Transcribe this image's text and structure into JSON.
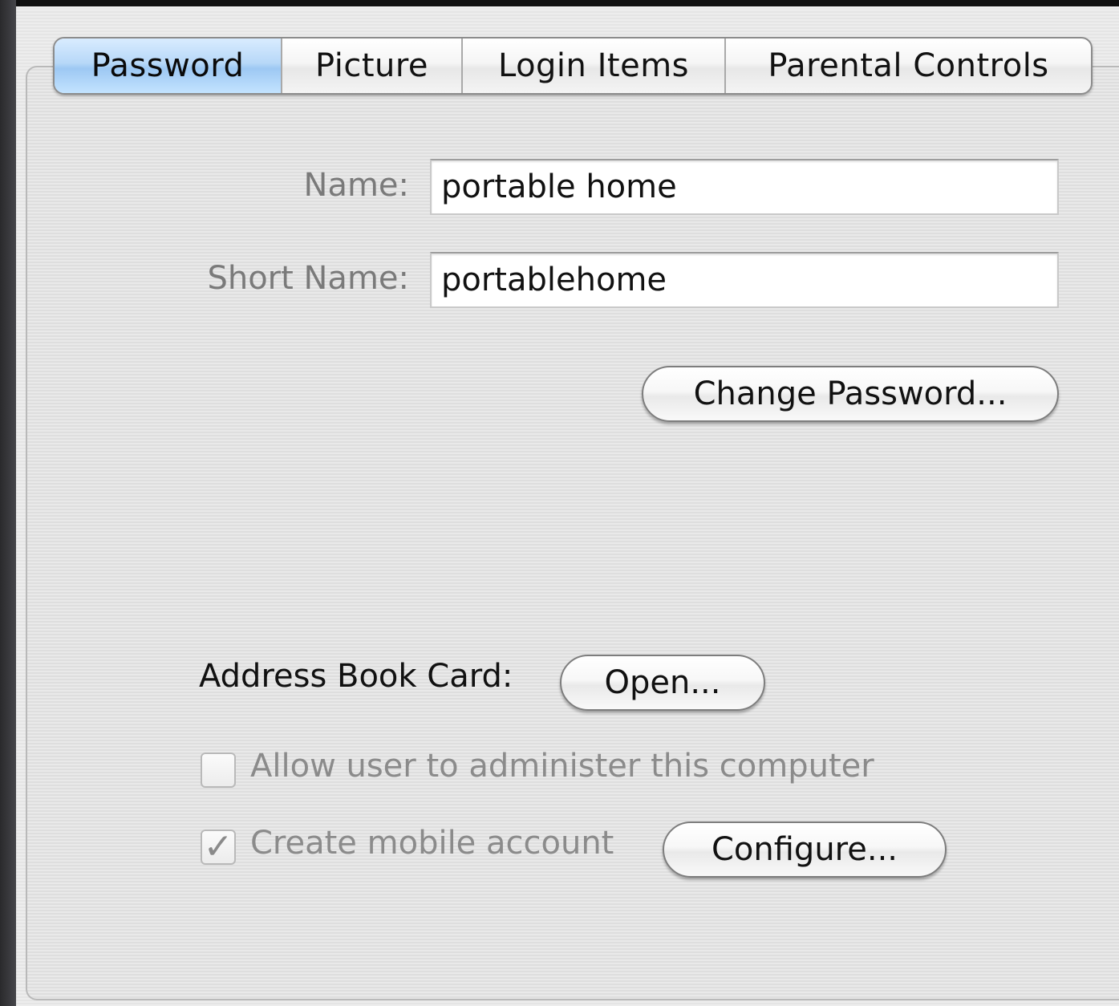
{
  "tabs": [
    {
      "label": "Password",
      "selected": true
    },
    {
      "label": "Picture",
      "selected": false
    },
    {
      "label": "Login Items",
      "selected": false
    },
    {
      "label": "Parental Controls",
      "selected": false
    }
  ],
  "form": {
    "name_label": "Name:",
    "name_value": "portable home",
    "short_name_label": "Short Name:",
    "short_name_value": "portablehome",
    "change_password_label": "Change Password...",
    "address_book_label": "Address Book Card:",
    "open_label": "Open...",
    "admin_checkbox_label": "Allow user to administer this computer",
    "admin_checked": false,
    "mobile_checkbox_label": "Create mobile account",
    "mobile_checked": true,
    "check_glyph": "✓",
    "configure_label": "Configure..."
  },
  "colors": {
    "selected_tab": "#b7d8f8",
    "disabled_text": "#8b8b8b"
  }
}
